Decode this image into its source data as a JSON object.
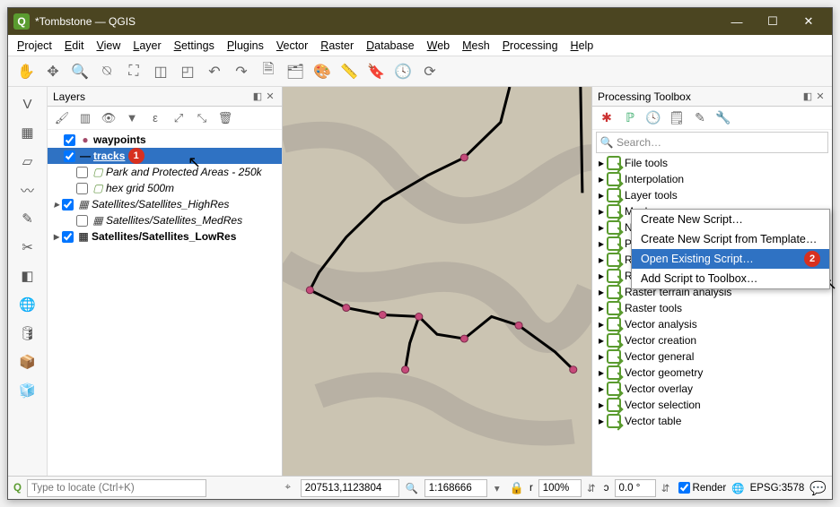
{
  "title": "*Tombstone — QGIS",
  "menus": [
    "Project",
    "Edit",
    "View",
    "Layer",
    "Settings",
    "Plugins",
    "Vector",
    "Raster",
    "Database",
    "Web",
    "Mesh",
    "Processing",
    "Help"
  ],
  "layers_panel": {
    "title": "Layers",
    "items": [
      {
        "checked": true,
        "symbol": "●",
        "symcolor": "#a34a6a",
        "label": "waypoints",
        "bold": true
      },
      {
        "checked": true,
        "symbol": "—",
        "symcolor": "#000",
        "label": "tracks",
        "bold": true,
        "selected": true,
        "callout": "1"
      },
      {
        "checked": false,
        "symbol": "▢",
        "symcolor": "#6a9b4a",
        "label": "Park and Protected Areas - 250k",
        "italic": true,
        "indent": 1
      },
      {
        "checked": false,
        "symbol": "▢",
        "symcolor": "#6a9b4a",
        "label": "hex grid 500m",
        "italic": true,
        "indent": 1
      },
      {
        "checked": true,
        "symbol": "▦",
        "symcolor": "#444",
        "label": "Satellites/Satellites_HighRes",
        "italic": true,
        "expand": true
      },
      {
        "checked": false,
        "symbol": "▦",
        "symcolor": "#444",
        "label": "Satellites/Satellites_MedRes",
        "italic": true,
        "indent": 1
      },
      {
        "checked": true,
        "symbol": "▦",
        "symcolor": "#444",
        "label": "Satellites/Satellites_LowRes",
        "bold": true,
        "expand": true
      }
    ]
  },
  "toolbox_panel": {
    "title": "Processing Toolbox",
    "search_placeholder": "Search…",
    "groups": [
      "File tools",
      "Interpolation",
      "Layer tools",
      "Mesh",
      "Network analysis",
      "Plots",
      "Raster analysis",
      "Raster creation",
      "Raster terrain analysis",
      "Raster tools",
      "Vector analysis",
      "Vector creation",
      "Vector general",
      "Vector geometry",
      "Vector overlay",
      "Vector selection",
      "Vector table"
    ]
  },
  "dropdown": {
    "items": [
      {
        "label": "Create New Script…"
      },
      {
        "label": "Create New Script from Template…"
      },
      {
        "label": "Open Existing Script…",
        "selected": true,
        "callout": "2"
      },
      {
        "label": "Add Script to Toolbox…"
      }
    ]
  },
  "status": {
    "locate_placeholder": "Type to locate (Ctrl+K)",
    "coord": "207513,1123804",
    "scale": "1:168666",
    "mag": "100%",
    "rot": "0.0 °",
    "render": "Render",
    "crs": "EPSG:3578"
  }
}
